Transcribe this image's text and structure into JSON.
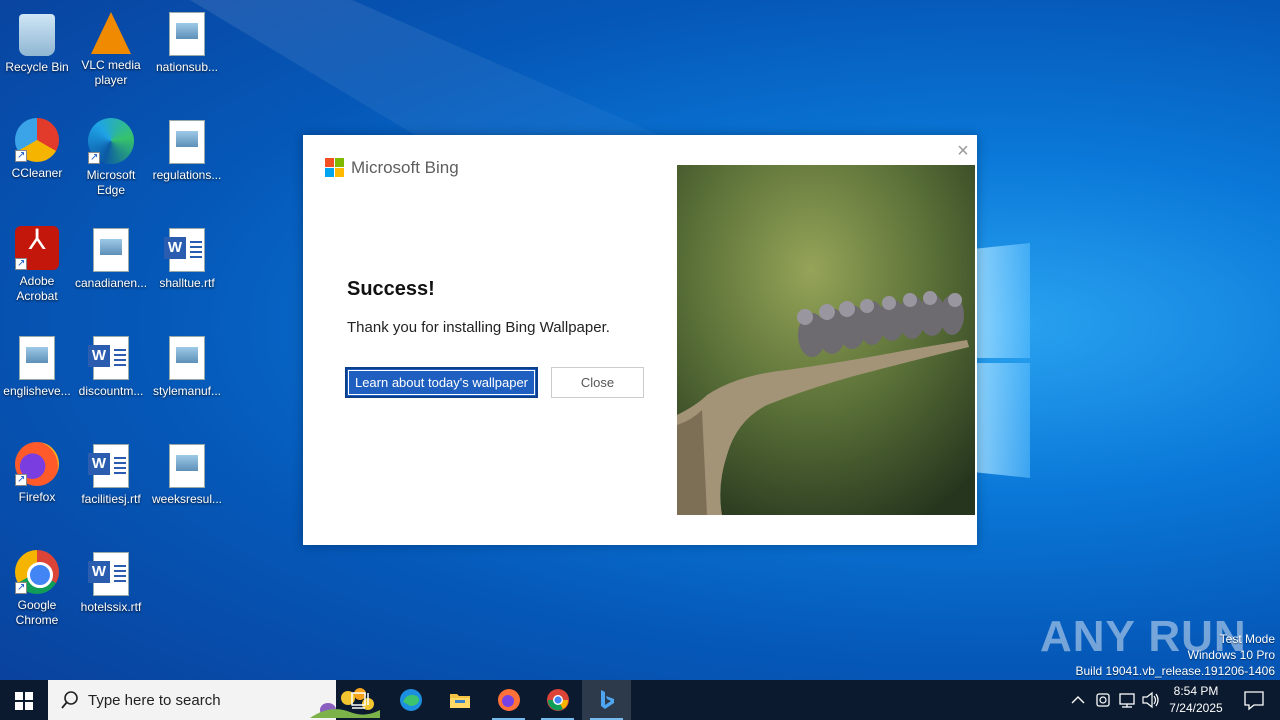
{
  "desktop": {
    "icons": [
      {
        "label": "Recycle Bin",
        "icon": "recycle-bin-icon"
      },
      {
        "label": "VLC media player",
        "icon": "vlc-icon"
      },
      {
        "label": "nationsub...",
        "icon": "image-file-icon"
      },
      {
        "label": "CCleaner",
        "icon": "ccleaner-icon"
      },
      {
        "label": "Microsoft Edge",
        "icon": "edge-icon"
      },
      {
        "label": "regulations...",
        "icon": "image-file-icon"
      },
      {
        "label": "Adobe Acrobat",
        "icon": "acrobat-icon"
      },
      {
        "label": "canadianen...",
        "icon": "image-file-icon"
      },
      {
        "label": "shalltue.rtf",
        "icon": "word-doc-icon"
      },
      {
        "label": "englisheve...",
        "icon": "image-file-icon"
      },
      {
        "label": "discountm...",
        "icon": "word-doc-icon"
      },
      {
        "label": "stylemanuf...",
        "icon": "image-file-icon"
      },
      {
        "label": "Firefox",
        "icon": "firefox-icon"
      },
      {
        "label": "facilitiesj.rtf",
        "icon": "word-doc-icon"
      },
      {
        "label": "weeksresul...",
        "icon": "image-file-icon"
      },
      {
        "label": "Google Chrome",
        "icon": "chrome-icon"
      },
      {
        "label": "hotelssix.rtf",
        "icon": "word-doc-icon"
      }
    ]
  },
  "dialog": {
    "brand": "Microsoft Bing",
    "title": "Success!",
    "message": "Thank you for installing Bing Wallpaper.",
    "primary_button": "Learn about today's wallpaper",
    "secondary_button": "Close",
    "close_glyph": "×"
  },
  "watermark": {
    "logo": "ANY RUN",
    "line1": "Test Mode",
    "line2": "Windows 10 Pro",
    "line3": "Build 19041.vb_release.191206-1406"
  },
  "taskbar": {
    "search_placeholder": "Type here to search",
    "apps": [
      "task-view-icon",
      "edge-icon",
      "file-explorer-icon",
      "firefox-icon",
      "chrome-icon",
      "bing-icon"
    ],
    "active_app": "bing-icon",
    "time": "8:54 PM",
    "date": "7/24/2025"
  }
}
